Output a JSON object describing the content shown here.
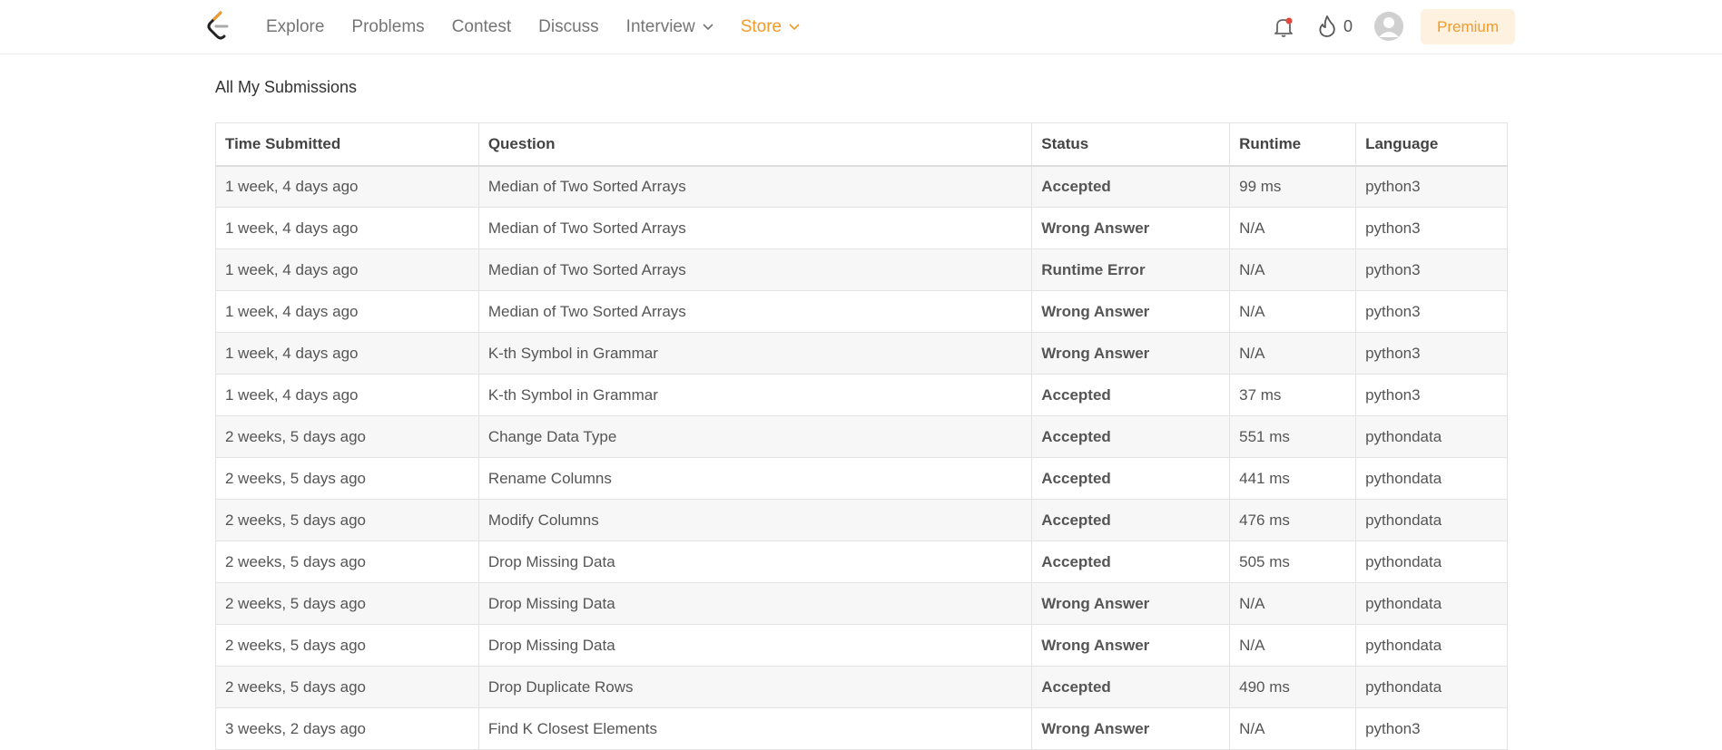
{
  "nav": {
    "links": [
      "Explore",
      "Problems",
      "Contest",
      "Discuss",
      "Interview",
      "Store"
    ],
    "fire_count": "0",
    "premium_label": "Premium"
  },
  "page": {
    "title": "All My Submissions"
  },
  "table": {
    "headers": [
      "Time Submitted",
      "Question",
      "Status",
      "Runtime",
      "Language"
    ],
    "rows": [
      {
        "time": "1 week, 4 days ago",
        "question": "Median of Two Sorted Arrays",
        "status": "Accepted",
        "runtime": "99 ms",
        "language": "python3"
      },
      {
        "time": "1 week, 4 days ago",
        "question": "Median of Two Sorted Arrays",
        "status": "Wrong Answer",
        "runtime": "N/A",
        "language": "python3"
      },
      {
        "time": "1 week, 4 days ago",
        "question": "Median of Two Sorted Arrays",
        "status": "Runtime Error",
        "runtime": "N/A",
        "language": "python3"
      },
      {
        "time": "1 week, 4 days ago",
        "question": "Median of Two Sorted Arrays",
        "status": "Wrong Answer",
        "runtime": "N/A",
        "language": "python3"
      },
      {
        "time": "1 week, 4 days ago",
        "question": "K-th Symbol in Grammar",
        "status": "Wrong Answer",
        "runtime": "N/A",
        "language": "python3"
      },
      {
        "time": "1 week, 4 days ago",
        "question": "K-th Symbol in Grammar",
        "status": "Accepted",
        "runtime": "37 ms",
        "language": "python3"
      },
      {
        "time": "2 weeks, 5 days ago",
        "question": "Change Data Type",
        "status": "Accepted",
        "runtime": "551 ms",
        "language": "pythondata"
      },
      {
        "time": "2 weeks, 5 days ago",
        "question": "Rename Columns",
        "status": "Accepted",
        "runtime": "441 ms",
        "language": "pythondata"
      },
      {
        "time": "2 weeks, 5 days ago",
        "question": "Modify Columns",
        "status": "Accepted",
        "runtime": "476 ms",
        "language": "pythondata"
      },
      {
        "time": "2 weeks, 5 days ago",
        "question": "Drop Missing Data",
        "status": "Accepted",
        "runtime": "505 ms",
        "language": "pythondata"
      },
      {
        "time": "2 weeks, 5 days ago",
        "question": "Drop Missing Data",
        "status": "Wrong Answer",
        "runtime": "N/A",
        "language": "pythondata"
      },
      {
        "time": "2 weeks, 5 days ago",
        "question": "Drop Missing Data",
        "status": "Wrong Answer",
        "runtime": "N/A",
        "language": "pythondata"
      },
      {
        "time": "2 weeks, 5 days ago",
        "question": "Drop Duplicate Rows",
        "status": "Accepted",
        "runtime": "490 ms",
        "language": "pythondata"
      },
      {
        "time": "3 weeks, 2 days ago",
        "question": "Find K Closest Elements",
        "status": "Wrong Answer",
        "runtime": "N/A",
        "language": "python3"
      }
    ]
  },
  "colors": {
    "accepted": "#3c9a3c",
    "error": "#d64545",
    "store_accent": "#f29b2b"
  },
  "icons": [
    "logo-icon",
    "chevron-down-icon",
    "bell-icon",
    "fire-icon",
    "avatar-icon"
  ]
}
